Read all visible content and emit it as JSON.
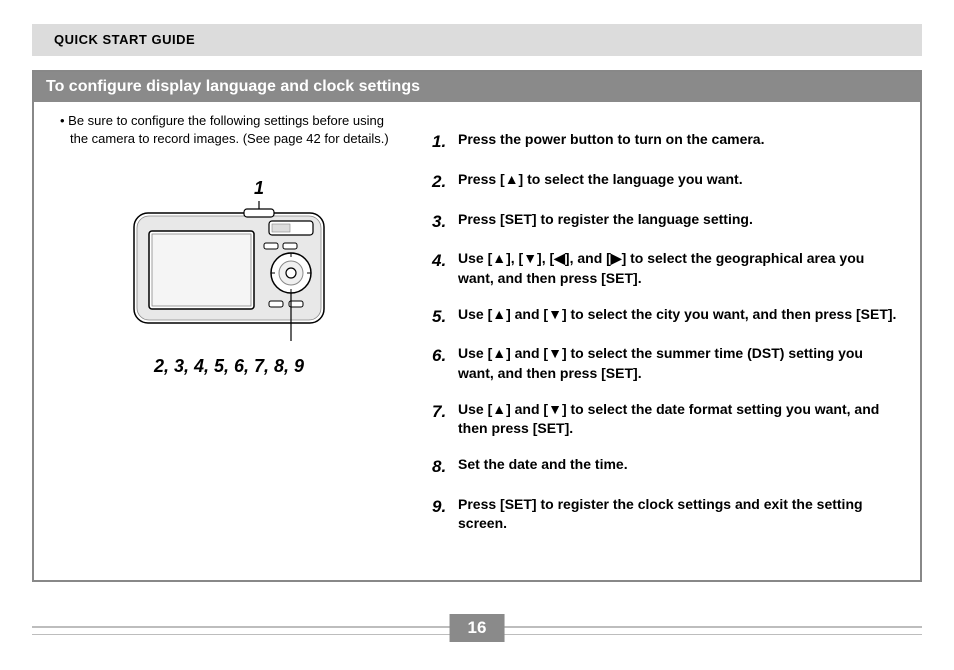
{
  "header": {
    "title": "QUICK START GUIDE"
  },
  "section": {
    "title": "To configure display language and clock settings",
    "note": "Be sure to configure the following settings before using the camera to record images. (See page 42 for details.)",
    "callout_top": "1",
    "callout_bottom": "2, 3, 4, 5, 6, 7, 8, 9"
  },
  "steps": [
    {
      "num": "1",
      "text": "Press the power button to turn on the camera."
    },
    {
      "num": "2",
      "text": "Press [▲] to select the language you want."
    },
    {
      "num": "3",
      "text": "Press [SET] to register the language setting."
    },
    {
      "num": "4",
      "text": "Use [▲], [▼], [◀], and [▶] to select the geographical area you want, and then press [SET]."
    },
    {
      "num": "5",
      "text": "Use [▲] and [▼] to select the city you want, and then press [SET]."
    },
    {
      "num": "6",
      "text": "Use [▲] and [▼] to select the summer time (DST) setting you want, and then press [SET]."
    },
    {
      "num": "7",
      "text": "Use [▲] and [▼] to select the date format setting you want, and then press [SET]."
    },
    {
      "num": "8",
      "text": "Set the date and the time."
    },
    {
      "num": "9",
      "text": "Press [SET] to register the clock settings and exit the setting screen."
    }
  ],
  "footer": {
    "page_number": "16"
  }
}
